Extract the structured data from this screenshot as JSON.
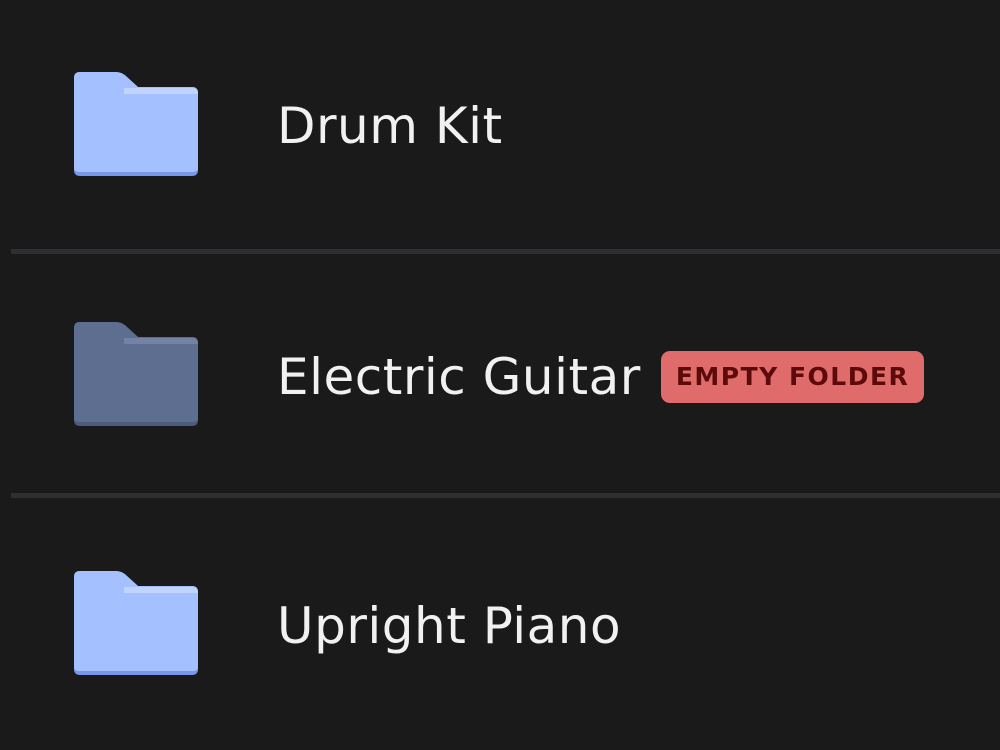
{
  "folders": [
    {
      "name": "Drum Kit",
      "icon": "folder-icon",
      "icon_color": "#a4c0ff",
      "icon_tab_color": "#c3d6ff",
      "icon_shadow_color": "#7897e8",
      "badge": null
    },
    {
      "name": "Electric Guitar",
      "icon": "folder-icon",
      "icon_color": "#5e6e90",
      "icon_tab_color": "#7585a8",
      "icon_shadow_color": "#4d5c7c",
      "badge": "EMPTY FOLDER",
      "badge_color": "#e06b6b",
      "badge_text_color": "#5c0a0a"
    },
    {
      "name": "Upright Piano",
      "icon": "folder-icon",
      "icon_color": "#a4c0ff",
      "icon_tab_color": "#c3d6ff",
      "icon_shadow_color": "#7897e8",
      "badge": null
    }
  ],
  "colors": {
    "background": "#1b1a1a",
    "divider": "#2e2f32",
    "text": "#f1f1f1"
  }
}
